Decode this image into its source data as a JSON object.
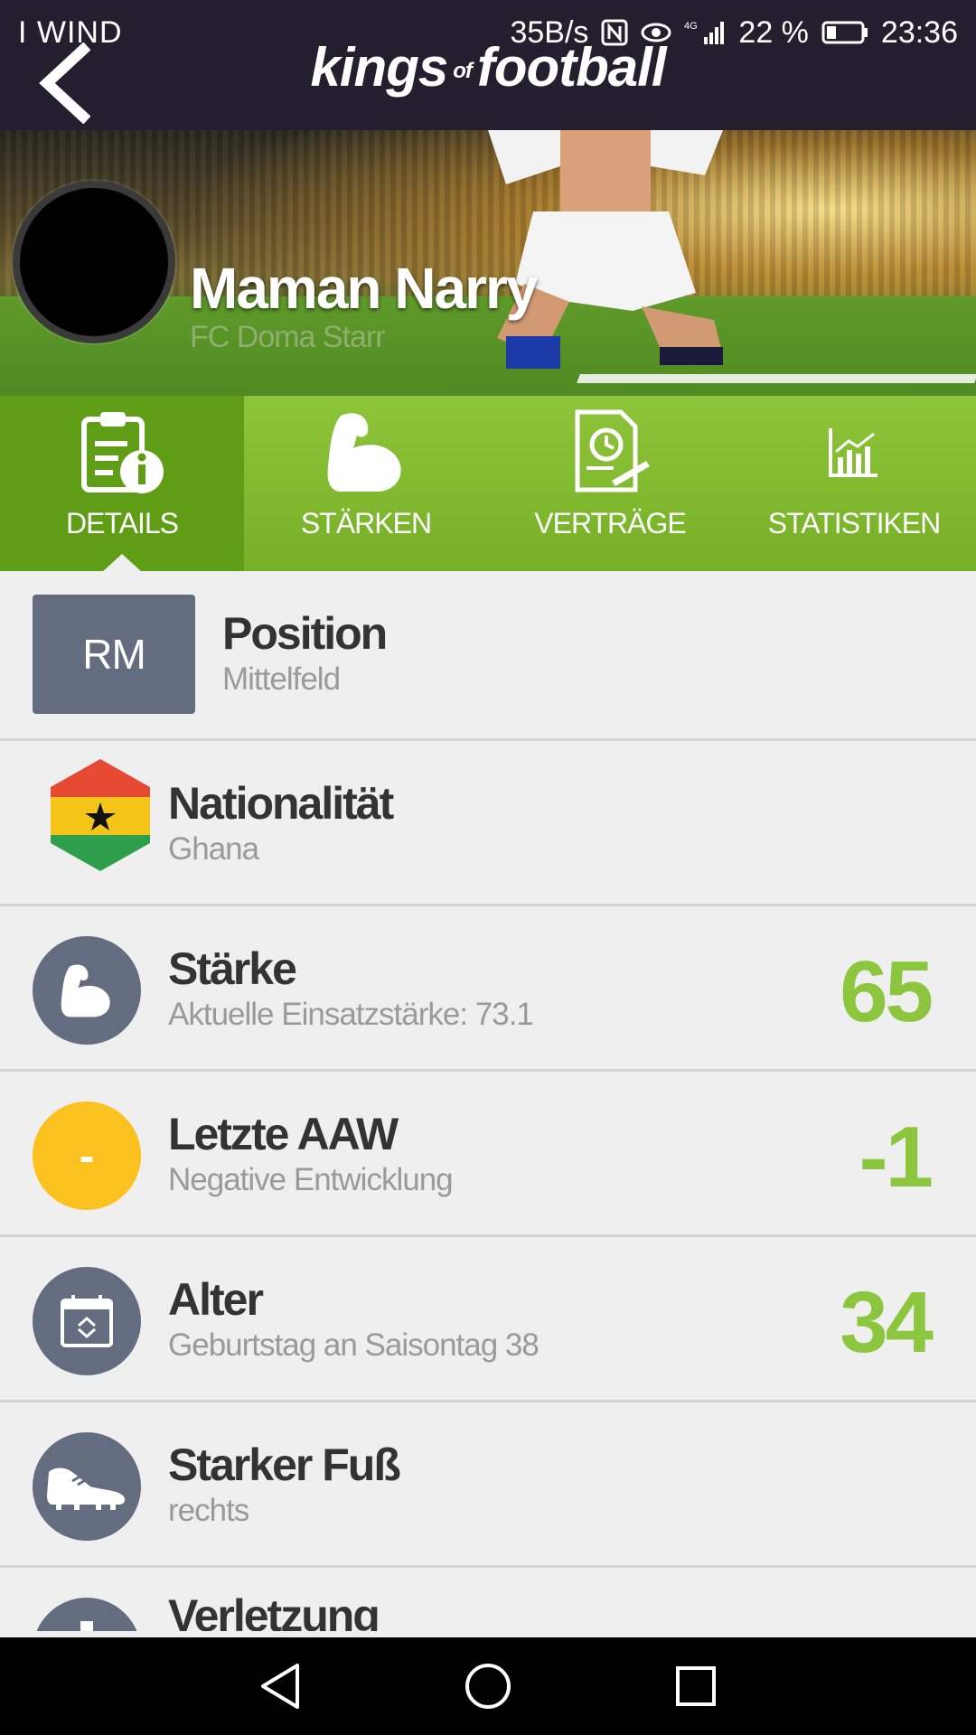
{
  "status_bar": {
    "carrier": "I WIND",
    "speed": "35B/s",
    "battery": "22 %",
    "time": "23:36",
    "network": "4G"
  },
  "header": {
    "logo_main": "kings",
    "logo_of": "of",
    "logo_end": "football",
    "back_icon": "chevron-left-icon"
  },
  "player": {
    "name": "Maman Narry",
    "club": "FC Doma Starr"
  },
  "tabs": [
    {
      "label": "DETAILS",
      "icon": "details-info-icon",
      "active": true
    },
    {
      "label": "STÄRKEN",
      "icon": "bicep-icon",
      "active": false
    },
    {
      "label": "VERTRÄGE",
      "icon": "contract-icon",
      "active": false
    },
    {
      "label": "STATISTIKEN",
      "icon": "chart-icon",
      "active": false
    }
  ],
  "rows": {
    "position": {
      "badge": "RM",
      "title": "Position",
      "sub": "Mittelfeld"
    },
    "nationality": {
      "title": "Nationalität",
      "sub": "Ghana",
      "icon": "ghana-flag-icon"
    },
    "strength": {
      "title": "Stärke",
      "sub": "Aktuelle Einsatzstärke: 73.1",
      "value": "65",
      "icon": "bicep-icon"
    },
    "last_aaw": {
      "title": "Letzte AAW",
      "sub": "Negative Entwicklung",
      "value": "-1",
      "badge": "-"
    },
    "age": {
      "title": "Alter",
      "sub": "Geburtstag an Saisontag 38",
      "value": "34",
      "icon": "calendar-icon"
    },
    "foot": {
      "title": "Starker Fuß",
      "sub": "rechts",
      "icon": "boot-icon"
    },
    "injury": {
      "title": "Verletzung",
      "icon": "exclamation-icon"
    }
  },
  "colors": {
    "header_bg": "#231f2e",
    "tab_green": "#76b026",
    "tab_active": "#5f9d16",
    "value_green": "#8cc63f",
    "icon_gray": "#646c80",
    "yellow": "#fbc21f"
  }
}
